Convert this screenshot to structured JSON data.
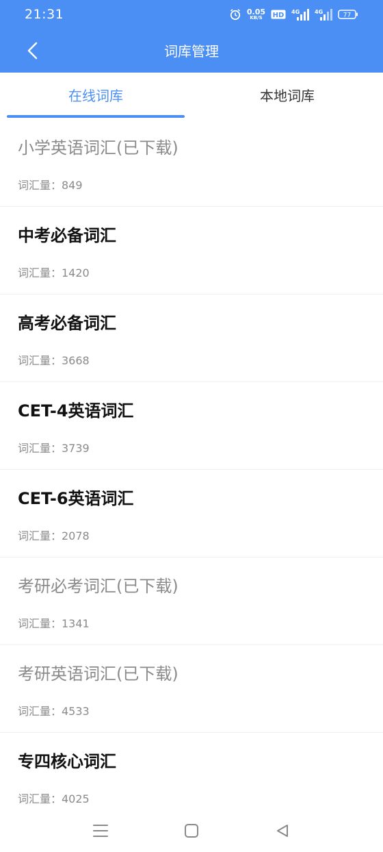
{
  "status_bar": {
    "time": "21:31",
    "net_speed_value": "0.05",
    "net_speed_unit": "KB/S",
    "hd_badge": "HD",
    "signal_1": "4G",
    "signal_2": "4G",
    "battery": "77",
    "icons": [
      "alarm-icon",
      "hd-icon",
      "signal-4g-icon",
      "signal-4g-icon",
      "battery-icon"
    ]
  },
  "header": {
    "title": "词库管理",
    "back_icon": "chevron-left-icon"
  },
  "tabs": [
    {
      "label": "在线词库",
      "active": true
    },
    {
      "label": "本地词库",
      "active": false
    }
  ],
  "vocab_list": [
    {
      "title": "小学英语词汇(已下载)",
      "count": "词汇量：849",
      "downloaded": true
    },
    {
      "title": "中考必备词汇",
      "count": "词汇量：1420",
      "downloaded": false
    },
    {
      "title": "高考必备词汇",
      "count": "词汇量：3668",
      "downloaded": false
    },
    {
      "title": "CET-4英语词汇",
      "count": "词汇量：3739",
      "downloaded": false
    },
    {
      "title": "CET-6英语词汇",
      "count": "词汇量：2078",
      "downloaded": false
    },
    {
      "title": "考研必考词汇(已下载)",
      "count": "词汇量：1341",
      "downloaded": true
    },
    {
      "title": "考研英语词汇(已下载)",
      "count": "词汇量：4533",
      "downloaded": true
    },
    {
      "title": "专四核心词汇",
      "count": "词汇量：4025",
      "downloaded": false
    }
  ],
  "nav_bar": {
    "icons": [
      "menu-icon",
      "home-icon",
      "back-triangle-icon"
    ]
  },
  "colors": {
    "accent": "#4b8ff4",
    "title_active": "#111111",
    "muted": "#8a8a8a"
  }
}
